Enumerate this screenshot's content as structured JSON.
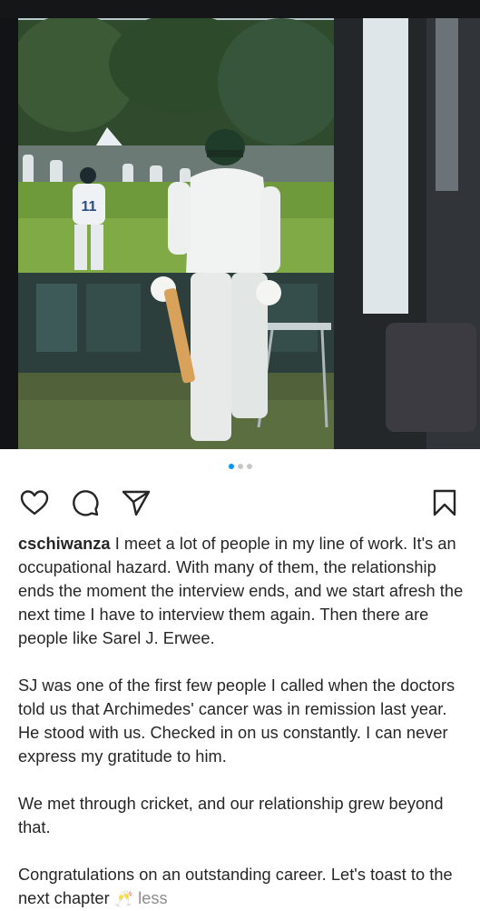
{
  "post": {
    "media": {
      "slide_count": 3,
      "active_slide": 1,
      "player_shirt_number": "11"
    },
    "actions": {
      "like_icon": "heart-icon",
      "comment_icon": "comment-icon",
      "share_icon": "send-icon",
      "save_icon": "bookmark-icon",
      "accent_color": "#0095f6"
    },
    "caption": {
      "username": "cschiwanza",
      "paragraphs": [
        "I meet a lot of people in my line of work. It's an occupational hazard. With many of them, the relationship ends the moment the interview ends, and we start afresh the next time I have to interview them again. Then there are people like Sarel J. Erwee.",
        "SJ was one of the first few people I called when the doctors told us that Archimedes' cancer was in remission last year. He stood with us. Checked in on us constantly. I can never express my gratitude to him.",
        "We met through cricket, and our relationship grew beyond that.",
        "Congratulations on an outstanding career. Let's toast to the next chapter"
      ],
      "emoji": "🥂",
      "less_label": "less"
    }
  }
}
